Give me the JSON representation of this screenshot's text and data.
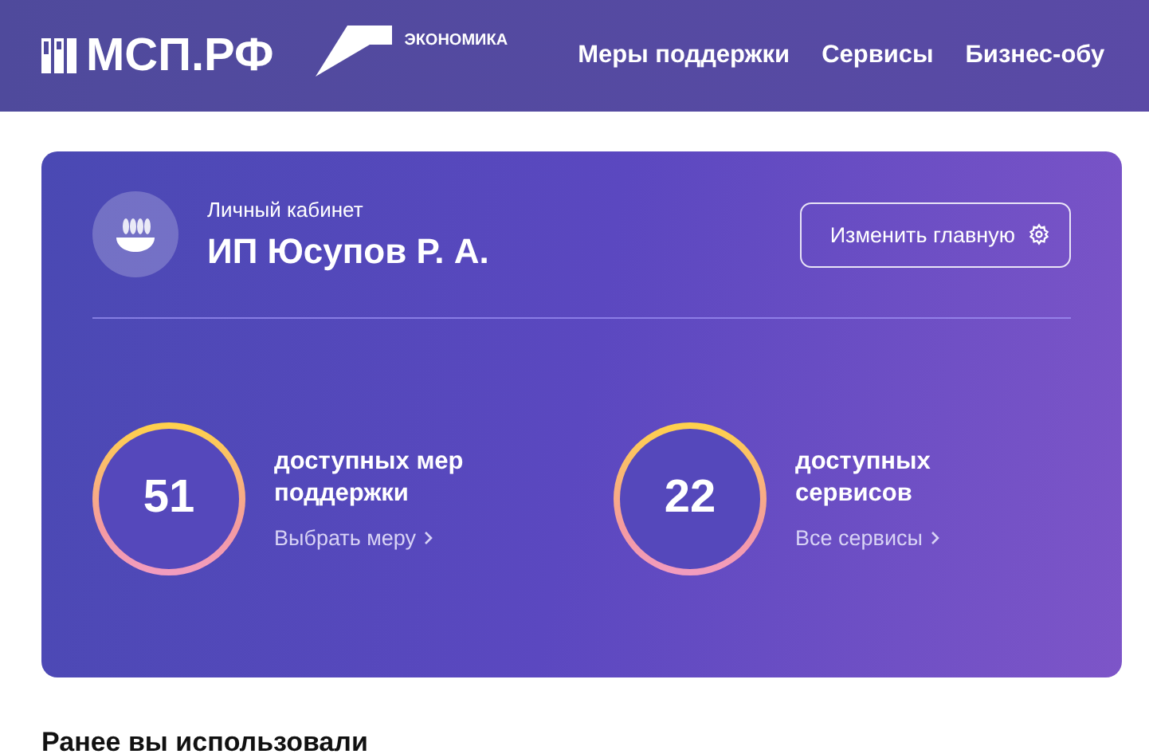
{
  "header": {
    "logo": "МСП.РФ",
    "partner": "ЭКОНОМИКА",
    "nav": [
      "Меры поддержки",
      "Сервисы",
      "Бизнес-обу"
    ]
  },
  "card": {
    "caption": "Личный кабинет",
    "name": "ИП Юсупов Р. А.",
    "edit_button": "Изменить главную",
    "counters": [
      {
        "number": "51",
        "caption": "доступных мер поддержки",
        "link": "Выбрать меру"
      },
      {
        "number": "22",
        "caption": "доступных сервисов",
        "link": "Все сервисы"
      }
    ]
  },
  "section_title": "Ранее вы использовали"
}
